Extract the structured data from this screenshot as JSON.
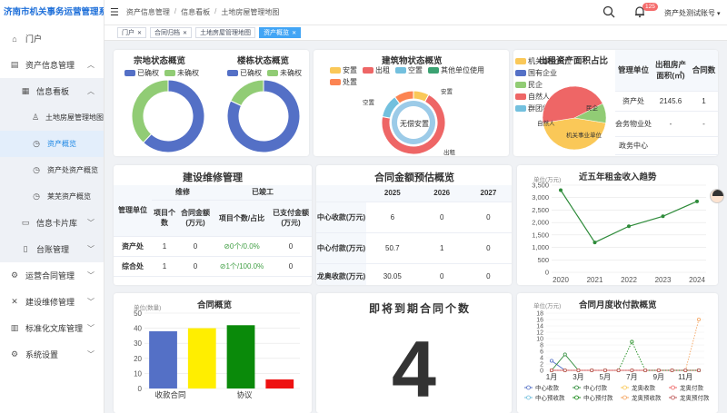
{
  "app": {
    "title": "济南市机关事务运营管理系统"
  },
  "sidebar": {
    "items": [
      {
        "label": "门户",
        "icon": "home-icon"
      },
      {
        "label": "资产信息管理",
        "icon": "folder-icon",
        "expanded": true
      },
      {
        "label": "信息看板",
        "icon": "dashboard-icon",
        "expanded": true
      },
      {
        "label": "土地房屋管理地图",
        "icon": "person-icon"
      },
      {
        "label": "资产概览",
        "icon": "clock-icon",
        "active": true
      },
      {
        "label": "资产处资产概览",
        "icon": "clock-icon"
      },
      {
        "label": "莱芜资产概览",
        "icon": "clock-icon"
      },
      {
        "label": "信息卡片库",
        "icon": "card-icon"
      },
      {
        "label": "台账管理",
        "icon": "ledger-icon"
      },
      {
        "label": "运营合同管理",
        "icon": "contract-icon"
      },
      {
        "label": "建设维修管理",
        "icon": "tools-icon"
      },
      {
        "label": "标准化文库管理",
        "icon": "library-icon"
      },
      {
        "label": "系统设置",
        "icon": "settings-icon"
      }
    ]
  },
  "header": {
    "breadcrumb": [
      "资产信息管理",
      "信息看板",
      "土地房屋管理地图"
    ],
    "notifications": "125",
    "account": "资产处测试账号"
  },
  "tabs": [
    {
      "label": "门户",
      "closable": true
    },
    {
      "label": "合同归档",
      "closable": true
    },
    {
      "label": "土地房屋管理地图",
      "closable": false
    },
    {
      "label": "资产概览",
      "closable": true,
      "active": true
    }
  ],
  "cards": {
    "land": {
      "title": "宗地状态概览",
      "legend": [
        "已确权",
        "未确权"
      ]
    },
    "building": {
      "title": "楼栋状态概览",
      "legend": [
        "已确权",
        "未确权"
      ]
    },
    "structure": {
      "title": "建筑物状态概览",
      "legend": [
        "安置",
        "出租",
        "空置",
        "其他单位使用",
        "处置"
      ],
      "labels": [
        "空置",
        "安置",
        "无偿安置",
        "出租"
      ]
    },
    "area": {
      "title": "出租资产面积占比",
      "legend": [
        "机关事业单位",
        "国有企业",
        "民企",
        "自然人",
        "群团组织"
      ],
      "pie_labels": [
        "自然人",
        "民企",
        "机关事业单位"
      ],
      "table": {
        "headers": [
          "管理单位",
          "出租房产面积(㎡)",
          "合同数"
        ],
        "rows": [
          [
            "资产处",
            "2145.6",
            "1"
          ],
          [
            "会务物业处",
            "-",
            "-"
          ],
          [
            "政务中心",
            "",
            ""
          ]
        ]
      }
    },
    "maintenance": {
      "title": "建设维修管理",
      "col_unit": "管理单位",
      "group_repair": "维修",
      "group_done": "已竣工",
      "sub": [
        "项目个数",
        "合同金额(万元)",
        "项目个数/占比",
        "已支付金额(万元)"
      ],
      "rows": [
        [
          "资产处",
          "1",
          "0",
          "0个/0.0%",
          "0"
        ],
        [
          "综合处",
          "1",
          "0",
          "1个/100.0%",
          "0"
        ]
      ]
    },
    "contract_estimate": {
      "title": "合同金额预估概览",
      "years": [
        "2025",
        "2026",
        "2027"
      ],
      "rows": [
        [
          "中心收款(万元)",
          "6",
          "0",
          "0"
        ],
        [
          "中心付款(万元)",
          "50.7",
          "1",
          "0"
        ],
        [
          "龙奥收款(万元)",
          "30.05",
          "0",
          "0"
        ]
      ]
    },
    "rent_trend": {
      "title": "近五年租金收入趋势",
      "unit": "单位(万元)"
    },
    "contract_overview": {
      "title": "合同概览",
      "unit": "单位(数量)",
      "labels": [
        "收款合同",
        "协议"
      ]
    },
    "expiring": {
      "title": "即将到期合同个数",
      "value": "4"
    },
    "monthly": {
      "title": "合同月度收付款概览",
      "unit": "单位(万元)",
      "legend": [
        "中心收款",
        "中心付款",
        "龙奥收款",
        "龙奥付款",
        "中心预收款",
        "中心预付款",
        "龙奥预收款",
        "龙奥预付款"
      ]
    }
  },
  "colors": {
    "blue": "#5470c6",
    "green": "#91cc75",
    "yellow": "#fac858",
    "red": "#ee6666",
    "cyan": "#73c0de",
    "accent": "#42a5f5"
  },
  "chart_data": [
    {
      "type": "pie",
      "title": "宗地状态概览",
      "categories": [
        "已确权",
        "未确权"
      ],
      "values": [
        62,
        38
      ]
    },
    {
      "type": "pie",
      "title": "楼栋状态概览",
      "categories": [
        "已确权",
        "未确权"
      ],
      "values": [
        82,
        18
      ]
    },
    {
      "type": "pie",
      "title": "建筑物状态概览",
      "categories": [
        "安置",
        "出租",
        "空置",
        "其他单位使用",
        "处置"
      ],
      "values": [
        8,
        70,
        12,
        0,
        10
      ]
    },
    {
      "type": "pie",
      "title": "出租资产面积占比",
      "categories": [
        "机关事业单位",
        "国有企业",
        "民企",
        "自然人",
        "群团组织"
      ],
      "values": [
        45,
        0,
        10,
        45,
        0
      ]
    },
    {
      "type": "line",
      "title": "近五年租金收入趋势",
      "ylabel": "单位(万元)",
      "x": [
        "2020",
        "2021",
        "2022",
        "2023",
        "2024"
      ],
      "series": [
        {
          "values": [
            3300,
            1200,
            1850,
            2250,
            2850
          ]
        }
      ],
      "ylim": [
        0,
        3500
      ],
      "yticks": [
        "0",
        "500",
        "1,000",
        "1,500",
        "2,000",
        "2,500",
        "3,000",
        "3,500"
      ]
    },
    {
      "type": "bar",
      "title": "合同概览",
      "ylabel": "单位(数量)",
      "categories": [
        "收款合同",
        "",
        "协议",
        ""
      ],
      "values": [
        38,
        40,
        42,
        6
      ],
      "ylim": [
        0,
        50
      ],
      "yticks": [
        "0",
        "10",
        "20",
        "30",
        "40",
        "50"
      ]
    },
    {
      "type": "line",
      "title": "合同月度收付款概览",
      "ylabel": "单位(万元)",
      "x": [
        "1月",
        "2月",
        "3月",
        "4月",
        "5月",
        "6月",
        "7月",
        "8月",
        "9月",
        "10月",
        "11月",
        "12月"
      ],
      "xticks": [
        "1月",
        "3月",
        "5月",
        "7月",
        "9月",
        "11月"
      ],
      "ylim": [
        0,
        18
      ],
      "yticks": [
        "0",
        "2",
        "4",
        "6",
        "8",
        "10",
        "12",
        "14",
        "16",
        "18"
      ],
      "series": [
        {
          "name": "中心收款",
          "values": [
            3,
            0,
            0,
            0,
            0,
            0,
            0,
            0,
            0,
            0,
            0,
            0
          ]
        },
        {
          "name": "中心付款",
          "values": [
            0,
            5,
            0,
            0,
            0,
            0,
            0,
            0,
            0,
            0,
            0,
            0
          ]
        },
        {
          "name": "龙奥收款",
          "values": [
            0,
            0,
            0,
            0,
            0,
            0,
            0,
            0,
            0,
            0,
            0,
            0
          ]
        },
        {
          "name": "龙奥付款",
          "values": [
            0,
            0,
            0,
            0,
            0,
            0,
            0,
            0,
            0,
            0,
            0,
            0
          ]
        },
        {
          "name": "中心预收款",
          "values": [
            0,
            0,
            0,
            0,
            0,
            0,
            0,
            0,
            0,
            0,
            0,
            0
          ]
        },
        {
          "name": "中心预付款",
          "values": [
            0,
            0,
            0,
            0,
            0,
            0,
            9,
            0,
            0,
            0,
            0,
            0
          ]
        },
        {
          "name": "龙奥预收款",
          "values": [
            0,
            0,
            0,
            0,
            0,
            0,
            0,
            0,
            0,
            0,
            0,
            16
          ]
        },
        {
          "name": "龙奥预付款",
          "values": [
            0,
            0,
            0,
            0,
            0,
            0,
            0,
            0,
            0,
            0,
            0,
            0
          ]
        }
      ]
    }
  ]
}
